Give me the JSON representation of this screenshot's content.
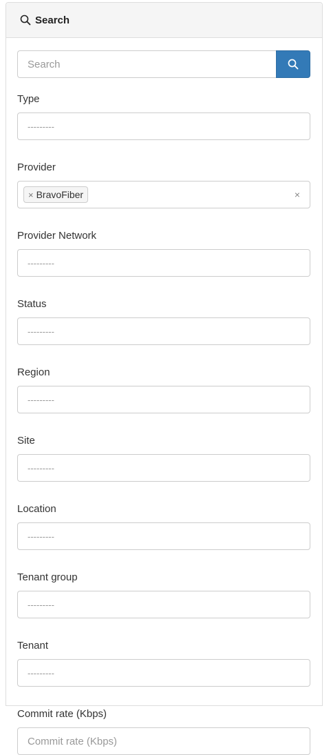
{
  "panel": {
    "title": "Search"
  },
  "search": {
    "placeholder": "Search"
  },
  "fields": {
    "type": {
      "label": "Type",
      "placeholder": "---------"
    },
    "provider": {
      "label": "Provider",
      "selected_tag": "BravoFiber",
      "tag_remove": "×",
      "clear": "×"
    },
    "provider_network": {
      "label": "Provider Network",
      "placeholder": "---------"
    },
    "status": {
      "label": "Status",
      "placeholder": "---------"
    },
    "region": {
      "label": "Region",
      "placeholder": "---------"
    },
    "site": {
      "label": "Site",
      "placeholder": "---------"
    },
    "location": {
      "label": "Location",
      "placeholder": "---------"
    },
    "tenant_group": {
      "label": "Tenant group",
      "placeholder": "---------"
    },
    "tenant": {
      "label": "Tenant",
      "placeholder": "---------"
    },
    "commit_rate": {
      "label": "Commit rate (Kbps)",
      "placeholder": "Commit rate (Kbps)"
    }
  },
  "colors": {
    "primary": "#337ab7",
    "heading_bg": "#f5f5f5",
    "border": "#cccccc"
  },
  "icons": {
    "heading": "search-icon",
    "button": "search-icon"
  }
}
